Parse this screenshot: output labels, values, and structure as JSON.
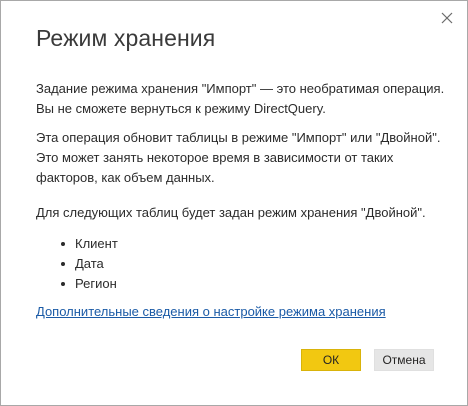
{
  "dialog": {
    "title": "Режим хранения",
    "paragraph1": "Задание режима хранения \"Импорт\" — это необратимая операция. Вы не сможете вернуться к режиму DirectQuery.",
    "paragraph2": "Эта операция обновит таблицы в режиме \"Импорт\" или \"Двойной\". Это может занять некоторое время в зависимости от таких факторов, как объем данных.",
    "paragraph3": "Для следующих таблиц будет задан режим хранения \"Двойной\".",
    "tables": [
      "Клиент",
      "Дата",
      "Регион"
    ],
    "link_text": "Дополнительные сведения о настройке режима хранения",
    "ok_label": "ОК",
    "cancel_label": "Отмена",
    "close_icon": "close-icon"
  },
  "colors": {
    "primary_button": "#f2c811",
    "secondary_button": "#e6e6e6",
    "link": "#1a5aa6",
    "border": "#a8a8a8"
  }
}
